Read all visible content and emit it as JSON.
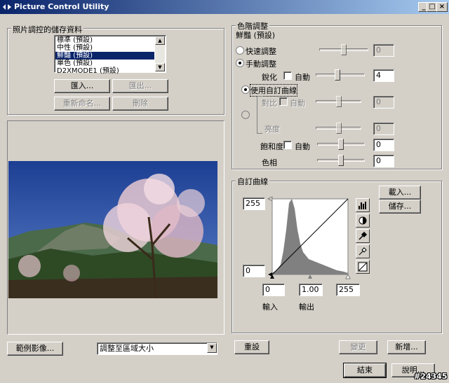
{
  "window": {
    "title": "Picture Control Utility",
    "min_label": "_",
    "max_label": "□",
    "close_label": "×"
  },
  "storage": {
    "group_label": "照片調控的儲存資料",
    "items": [
      "標準 (預設)",
      "中性 (預設)",
      "鮮豔 (預設)",
      "單色 (預設)",
      "D2XMODE1 (預設)"
    ],
    "selected_index": 2,
    "import_label": "匯入...",
    "export_label": "匯出...",
    "rename_label": "重新命名...",
    "delete_label": "刪除"
  },
  "preview": {
    "sample_button": "範例影像...",
    "fit_select": "調整至區域大小"
  },
  "levels": {
    "group_label": "色階調整",
    "mode_title": "鮮豔 (預設)",
    "quick_label": "快速調整",
    "quick_value": "0",
    "manual_label": "手動調整",
    "sharpen_label": "銳化",
    "auto_label": "自動",
    "sharpen_value": "4",
    "custom_curve_label": "使用自訂曲線",
    "contrast_label": "對比",
    "contrast_auto_label": "自動",
    "contrast_value": "0",
    "brightness_label": "亮度",
    "brightness_value": "0",
    "saturation_label": "飽和度",
    "saturation_auto_label": "自動",
    "saturation_value": "0",
    "hue_label": "色相",
    "hue_value": "0",
    "quick_level": 0.5,
    "sharpen_level": 0.44,
    "contrast_level": 0.5,
    "brightness_level": 0.5,
    "saturation_level": 0.5,
    "hue_level": 0.5
  },
  "curve": {
    "group_label": "自訂曲線",
    "load_label": "載入...",
    "save_label": "儲存...",
    "output_max": "255",
    "output_min": "0",
    "input_min": "0",
    "gamma": "1.00",
    "input_max": "255",
    "input_label": "輸入",
    "output_label": "輸出",
    "tools": [
      "histogram-icon",
      "contrast-icon",
      "eyedropper-black-icon",
      "eyedropper-white-icon",
      "curve-reset-icon"
    ]
  },
  "footer": {
    "reset_label": "重設",
    "change_label": "變更",
    "new_label": "新增...",
    "close_label": "結束",
    "help_label": "說明..."
  },
  "watermark": "#24345"
}
